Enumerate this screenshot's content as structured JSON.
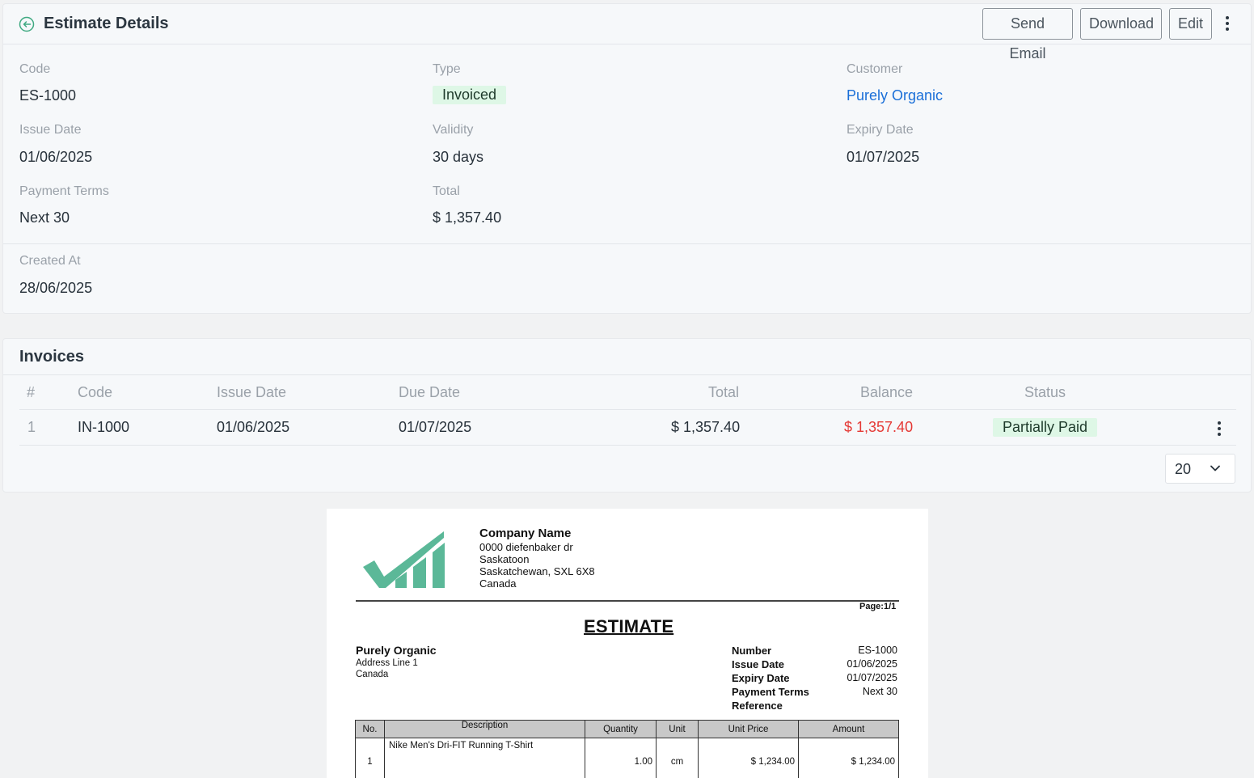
{
  "header": {
    "title": "Estimate Details",
    "buttons": {
      "send_email": "Send Email",
      "download": "Download",
      "edit": "Edit"
    }
  },
  "details": {
    "code": {
      "label": "Code",
      "value": "ES-1000"
    },
    "type": {
      "label": "Type",
      "value": "Invoiced"
    },
    "customer": {
      "label": "Customer",
      "value": "Purely Organic"
    },
    "issue_date": {
      "label": "Issue Date",
      "value": "01/06/2025"
    },
    "validity": {
      "label": "Validity",
      "value": "30 days"
    },
    "expiry_date": {
      "label": "Expiry Date",
      "value": "01/07/2025"
    },
    "payment_terms": {
      "label": "Payment Terms",
      "value": "Next 30"
    },
    "total": {
      "label": "Total",
      "value": "$ 1,357.40"
    },
    "created_at": {
      "label": "Created At",
      "value": "28/06/2025"
    }
  },
  "invoices": {
    "title": "Invoices",
    "columns": [
      "#",
      "Code",
      "Issue Date",
      "Due Date",
      "Total",
      "Balance",
      "Status"
    ],
    "rows": [
      {
        "num": "1",
        "code": "IN-1000",
        "issue_date": "01/06/2025",
        "due_date": "01/07/2025",
        "total": "$ 1,357.40",
        "balance": "$ 1,357.40",
        "status": "Partially Paid"
      }
    ],
    "page_size": "20"
  },
  "document": {
    "company": {
      "name": "Company Name",
      "address": [
        "0000 diefenbaker dr",
        "Saskatoon",
        "Saskatchewan, SXL 6X8",
        "Canada"
      ]
    },
    "page": "Page:1/1",
    "title": "ESTIMATE",
    "bill_to": {
      "name": "Purely Organic",
      "lines": [
        "Address Line 1",
        "Canada"
      ]
    },
    "meta": {
      "number": {
        "label": "Number",
        "value": "ES-1000"
      },
      "issue_date": {
        "label": "Issue Date",
        "value": "01/06/2025"
      },
      "expiry_date": {
        "label": "Expiry Date",
        "value": "01/07/2025"
      },
      "payment_terms": {
        "label": "Payment Terms",
        "value": "Next 30"
      },
      "reference": {
        "label": "Reference",
        "value": ""
      }
    },
    "table": {
      "columns": [
        "No.",
        "Description",
        "Quantity",
        "Unit",
        "Unit Price",
        "Amount"
      ],
      "rows": [
        {
          "no": "1",
          "description": "Nike Men's Dri-FIT Running T-Shirt",
          "quantity": "1.00",
          "unit": "cm",
          "unit_price": "$ 1,234.00",
          "amount": "$ 1,234.00"
        }
      ]
    },
    "logo_color": "#5bb898"
  },
  "colors": {
    "accent": "#1a6fd8",
    "success_bg": "#def7e6",
    "danger": "#e53935",
    "back_icon": "#3fa981"
  }
}
